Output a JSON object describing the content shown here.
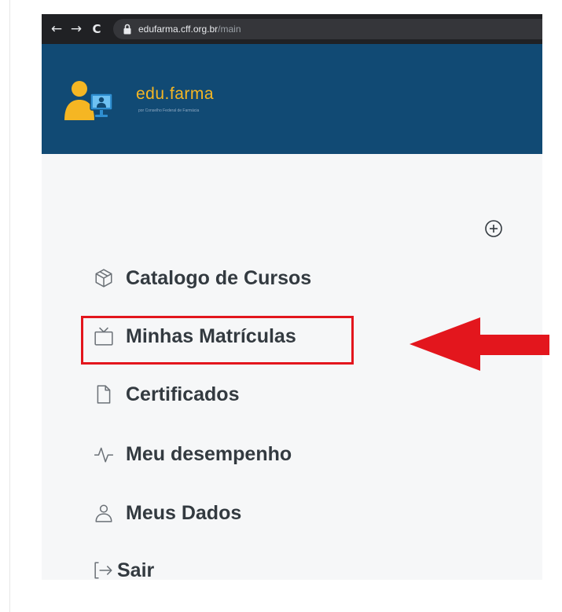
{
  "browser": {
    "url_host": "edufarma.cff.org.br",
    "url_path": "/main"
  },
  "header": {
    "brand_name": "edu.farma",
    "brand_tagline": "por Conselho Federal de Farmácia"
  },
  "sidebar": {
    "items": [
      {
        "label": "Catalogo de Cursos",
        "icon": "package-icon"
      },
      {
        "label": "Minhas Matrículas",
        "icon": "tv-icon",
        "highlighted": true
      },
      {
        "label": "Certificados",
        "icon": "file-icon"
      },
      {
        "label": "Meu desempenho",
        "icon": "activity-icon"
      },
      {
        "label": "Meus Dados",
        "icon": "user-icon"
      },
      {
        "label": "Sair",
        "icon": "log-out-icon"
      }
    ]
  },
  "colors": {
    "header_bg": "#114a74",
    "brand_accent": "#f5b623",
    "sidebar_bg": "#f6f7f8",
    "menu_text": "#333a40",
    "highlight": "#e3161d"
  }
}
